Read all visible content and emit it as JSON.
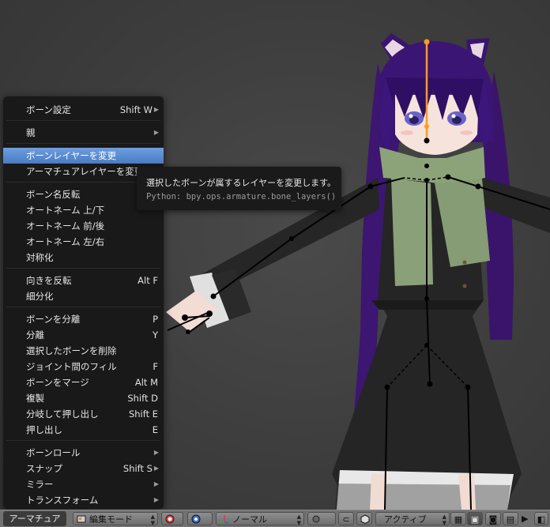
{
  "menu": {
    "items": [
      {
        "label": "ボーン設定",
        "shortcut": "Shift W",
        "submenu": true
      },
      {
        "label": "親",
        "shortcut": "",
        "submenu": true
      },
      {
        "label": "ボーンレイヤーを変更",
        "shortcut": "",
        "highlighted": true
      },
      {
        "label": "アーマチュアレイヤーを変更",
        "shortcut": ""
      },
      {
        "label": "ボーン名反転",
        "shortcut": ""
      },
      {
        "label": "オートネーム 上/下",
        "shortcut": ""
      },
      {
        "label": "オートネーム 前/後",
        "shortcut": ""
      },
      {
        "label": "オートネーム 左/右",
        "shortcut": ""
      },
      {
        "label": "対称化",
        "shortcut": ""
      },
      {
        "label": "向きを反転",
        "shortcut": "Alt F"
      },
      {
        "label": "細分化",
        "shortcut": ""
      },
      {
        "label": "ボーンを分離",
        "shortcut": "P"
      },
      {
        "label": "分離",
        "shortcut": "Y"
      },
      {
        "label": "選択したボーンを削除",
        "shortcut": ""
      },
      {
        "label": "ジョイント間のフィル",
        "shortcut": "F"
      },
      {
        "label": "ボーンをマージ",
        "shortcut": "Alt M"
      },
      {
        "label": "複製",
        "shortcut": "Shift D"
      },
      {
        "label": "分岐して押し出し",
        "shortcut": "Shift E"
      },
      {
        "label": "押し出し",
        "shortcut": "E"
      },
      {
        "label": "ボーンロール",
        "shortcut": "",
        "submenu": true
      },
      {
        "label": "スナップ",
        "shortcut": "Shift S",
        "submenu": true
      },
      {
        "label": "ミラー",
        "shortcut": "",
        "submenu": true
      },
      {
        "label": "トランスフォーム",
        "shortcut": "",
        "submenu": true
      }
    ]
  },
  "tooltip": {
    "description": "選択したボーンが属するレイヤーを変更します。",
    "python": "Python: bpy.ops.armature.bone_layers()"
  },
  "header": {
    "menu_label": "アーマチュア",
    "mode": "編集モード",
    "pivot": "ノーマル",
    "orientation": "アクティブ"
  },
  "colors": {
    "highlight": "#5680c2",
    "menu_bg": "#191919",
    "header_bg": "#727272",
    "active_bone": "#ff9a1e"
  }
}
